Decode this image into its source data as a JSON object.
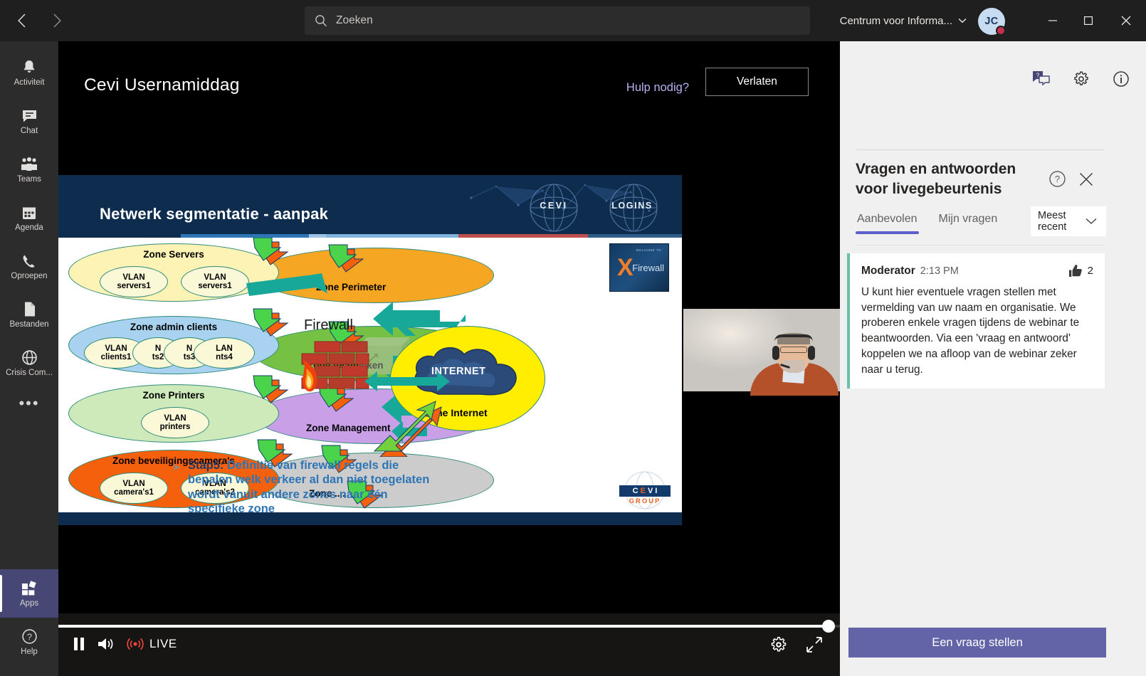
{
  "titlebar": {
    "back_label": "‹",
    "forward_label": "›",
    "search_placeholder": "Zoeken",
    "account_name": "Centrum voor Informa...",
    "account_chevron": "⌄",
    "avatar_initials": "JC",
    "minimize_label": "—",
    "maximize_label": "☐",
    "close_label": "✕"
  },
  "rail": {
    "items": [
      {
        "label": "Activiteit",
        "icon": "bell-icon"
      },
      {
        "label": "Chat",
        "icon": "chat-icon"
      },
      {
        "label": "Teams",
        "icon": "teams-icon"
      },
      {
        "label": "Agenda",
        "icon": "calendar-icon"
      },
      {
        "label": "Oproepen",
        "icon": "phone-icon"
      },
      {
        "label": "Bestanden",
        "icon": "file-icon"
      },
      {
        "label": "Crisis Com...",
        "icon": "globe-icon"
      }
    ],
    "more_label": "•••",
    "apps": {
      "label": "Apps",
      "icon": "apps-icon"
    },
    "help": {
      "label": "Help",
      "icon": "help-icon"
    }
  },
  "meeting": {
    "title": "Cevi Usernamiddag",
    "help_link": "Hulp nodig?",
    "leave_button": "Verlaten"
  },
  "slide": {
    "header_title": "Netwerk segmentatie - aanpak",
    "logo_left": "CEVI",
    "logo_right": "LOGINS",
    "firewall_label": "Firewall",
    "internet_label": "INTERNET",
    "zone_internet_label": "Zone Internet",
    "fw_product_welcome": "WELCOME TO",
    "fw_product_x": "X",
    "fw_product_name": "Firewall",
    "zones_left": [
      {
        "name": "Zone Servers",
        "color": "#fdf3b4",
        "vlans": [
          {
            "l1": "VLAN",
            "l2": "servers1"
          },
          {
            "l1": "VLAN",
            "l2": "servers1"
          }
        ]
      },
      {
        "name": "Zone admin clients",
        "color": "#a8d2f0",
        "vlans": [
          {
            "l1": "VLAN",
            "l2": "clients1"
          },
          {
            "l1": "N",
            "l2": "ts2"
          },
          {
            "l1": "N",
            "l2": "ts3"
          },
          {
            "l1": "LAN",
            "l2": "nts4"
          }
        ]
      },
      {
        "name": "Zone Printers",
        "color": "#cfeaba",
        "vlans": [
          {
            "l1": "VLAN",
            "l2": "printers"
          }
        ]
      },
      {
        "name": "Zone beveiligingscamera's",
        "color": "#f4600c",
        "vlans": [
          {
            "l1": "VLAN",
            "l2": "camera's1"
          },
          {
            "l1": "VLAN",
            "l2": "camera's2"
          }
        ]
      }
    ],
    "zones_right": [
      {
        "name": "Zone Perimeter",
        "color": "#f5a623"
      },
      {
        "name": "Zone technieken",
        "color": "#76c043"
      },
      {
        "name": "Zone Management",
        "color": "#c9a0e8"
      },
      {
        "name": "Zone ....",
        "color": "#cccccc"
      }
    ],
    "step": {
      "bullet": "➤",
      "label": "Stap5:",
      "text": " Definitie van firewall regels die bepalen welk verkeer al dan niet toegelaten wordt vanuit andere zones naar één specifieke zone"
    },
    "footer_logo_main": "CEVI",
    "footer_logo_sub": "GROUP"
  },
  "player": {
    "pause_label": "pause-icon",
    "volume_label": "volume-icon",
    "live_icon": "broadcast-icon",
    "live_label": "LIVE",
    "settings_label": "gear-icon",
    "fullscreen_label": "fullscreen-icon",
    "progress_percent": 98
  },
  "qa": {
    "icon_qa": "qa-bubble-icon",
    "icon_settings": "gear-icon",
    "icon_info": "info-icon",
    "title": "Vragen en antwoorden voor livegebeurtenis",
    "help_icon": "help-circle-icon",
    "close_icon": "close-icon",
    "tabs": [
      {
        "label": "Aanbevolen",
        "selected": true
      },
      {
        "label": "Mijn vragen",
        "selected": false
      }
    ],
    "sort_value": "Meest recent",
    "sort_chevron": "⌄",
    "messages": [
      {
        "author": "Moderator",
        "time": "2:13 PM",
        "likes": "2",
        "body": "U kunt hier eventuele vragen stellen met vermelding van uw naam en organisatie. We proberen enkele vragen tijdens de webinar te beantwoorden. Via een 'vraag en antwoord' koppelen we na afloop van de webinar zeker naar u terug."
      }
    ],
    "ask_button": "Een vraag stellen",
    "accent_color": "#6264a7",
    "card_accent_color": "#6ac0a6"
  }
}
